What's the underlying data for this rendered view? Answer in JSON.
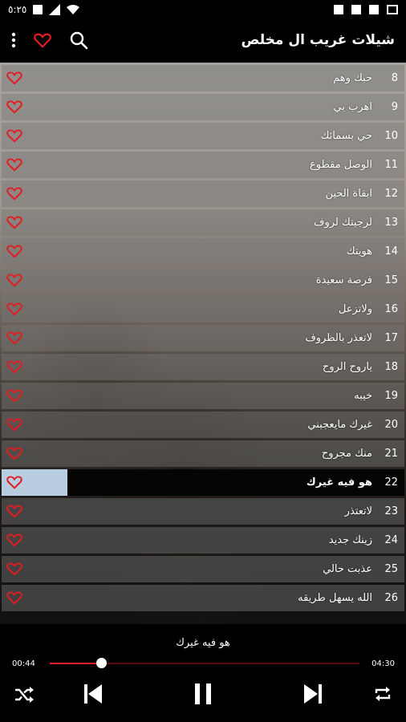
{
  "status": {
    "time": "٥:٢٥"
  },
  "app": {
    "title": "شيلات غريب ال مخلص"
  },
  "tracks": [
    {
      "num": "8",
      "title": "حبك وهم"
    },
    {
      "num": "9",
      "title": "اهرب بي"
    },
    {
      "num": "10",
      "title": "حي بسمائك"
    },
    {
      "num": "11",
      "title": "الوصل مقطوع"
    },
    {
      "num": "12",
      "title": "ابقاة الحين"
    },
    {
      "num": "13",
      "title": "لرجيتك لروف"
    },
    {
      "num": "14",
      "title": "هويتك"
    },
    {
      "num": "15",
      "title": "فرصة سعيدة"
    },
    {
      "num": "16",
      "title": "ولاتزعل"
    },
    {
      "num": "17",
      "title": "لاتعذر بالظروف"
    },
    {
      "num": "18",
      "title": "ياروح الروح"
    },
    {
      "num": "19",
      "title": "خيبه"
    },
    {
      "num": "20",
      "title": "غيرك مايعجبني"
    },
    {
      "num": "21",
      "title": "منك مجروح"
    },
    {
      "num": "22",
      "title": "هو فيه غيرك",
      "active": true
    },
    {
      "num": "23",
      "title": "لاتعتذر"
    },
    {
      "num": "24",
      "title": "زينك جديد"
    },
    {
      "num": "25",
      "title": "عذبت حالي"
    },
    {
      "num": "26",
      "title": "الله يسهل طريقه"
    }
  ],
  "player": {
    "now_title": "هو فيه غيرك",
    "current_time": "00:44",
    "total_time": "04:30",
    "progress": 0.166
  },
  "colors": {
    "accent": "#e31b23",
    "highlight": "#b8cde0"
  }
}
